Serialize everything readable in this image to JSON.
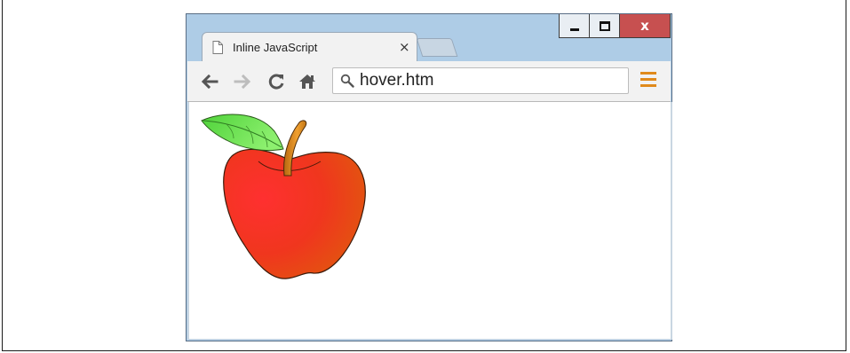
{
  "browser": {
    "tab": {
      "title": "Inline JavaScript",
      "close_glyph": "×",
      "icon": "page-icon"
    },
    "window_controls": {
      "minimize_icon": "minimize-icon",
      "maximize_icon": "maximize-icon",
      "close_label": "x",
      "close_color": "#c75050"
    },
    "toolbar": {
      "back_icon": "back-arrow-icon",
      "forward_icon": "forward-arrow-icon",
      "reload_icon": "reload-icon",
      "home_icon": "home-icon",
      "menu_icon": "hamburger-menu-icon",
      "menu_color": "#e08a1c"
    },
    "address_bar": {
      "search_icon": "search-icon",
      "value": "hover.htm"
    },
    "frame_color": "#aecce6"
  },
  "page": {
    "image": {
      "subject": "apple-image"
    }
  }
}
